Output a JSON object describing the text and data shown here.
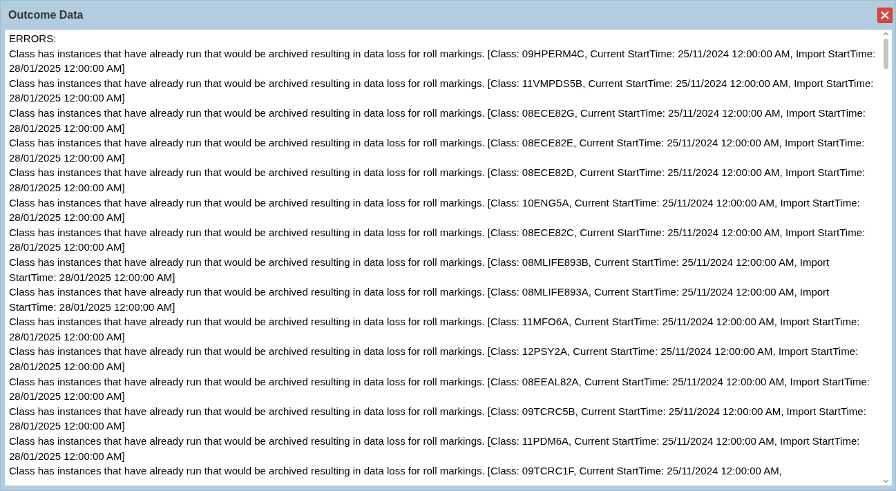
{
  "window": {
    "title": "Outcome Data"
  },
  "output": {
    "heading": "ERRORS:",
    "lines": [
      "Class has instances that have already run that would be archived resulting in data loss for roll markings. [Class: 09HPERM4C, Current StartTime: 25/11/2024 12:00:00 AM, Import StartTime: 28/01/2025 12:00:00 AM]",
      "Class has instances that have already run that would be archived resulting in data loss for roll markings. [Class: 11VMPDS5B, Current StartTime: 25/11/2024 12:00:00 AM, Import StartTime: 28/01/2025 12:00:00 AM]",
      "Class has instances that have already run that would be archived resulting in data loss for roll markings. [Class: 08ECE82G, Current StartTime: 25/11/2024 12:00:00 AM, Import StartTime: 28/01/2025 12:00:00 AM]",
      "Class has instances that have already run that would be archived resulting in data loss for roll markings. [Class: 08ECE82E, Current StartTime: 25/11/2024 12:00:00 AM, Import StartTime: 28/01/2025 12:00:00 AM]",
      "Class has instances that have already run that would be archived resulting in data loss for roll markings. [Class: 08ECE82D, Current StartTime: 25/11/2024 12:00:00 AM, Import StartTime: 28/01/2025 12:00:00 AM]",
      "Class has instances that have already run that would be archived resulting in data loss for roll markings. [Class: 10ENG5A, Current StartTime: 25/11/2024 12:00:00 AM, Import StartTime: 28/01/2025 12:00:00 AM]",
      "Class has instances that have already run that would be archived resulting in data loss for roll markings. [Class: 08ECE82C, Current StartTime: 25/11/2024 12:00:00 AM, Import StartTime: 28/01/2025 12:00:00 AM]",
      "Class has instances that have already run that would be archived resulting in data loss for roll markings. [Class: 08MLIFE893B, Current StartTime: 25/11/2024 12:00:00 AM, Import StartTime: 28/01/2025 12:00:00 AM]",
      "Class has instances that have already run that would be archived resulting in data loss for roll markings. [Class: 08MLIFE893A, Current StartTime: 25/11/2024 12:00:00 AM, Import StartTime: 28/01/2025 12:00:00 AM]",
      "Class has instances that have already run that would be archived resulting in data loss for roll markings. [Class: 11MFO6A, Current StartTime: 25/11/2024 12:00:00 AM, Import StartTime: 28/01/2025 12:00:00 AM]",
      "Class has instances that have already run that would be archived resulting in data loss for roll markings. [Class: 12PSY2A, Current StartTime: 25/11/2024 12:00:00 AM, Import StartTime: 28/01/2025 12:00:00 AM]",
      "Class has instances that have already run that would be archived resulting in data loss for roll markings. [Class: 08EEAL82A, Current StartTime: 25/11/2024 12:00:00 AM, Import StartTime: 28/01/2025 12:00:00 AM]",
      "Class has instances that have already run that would be archived resulting in data loss for roll markings. [Class: 09TCRC5B, Current StartTime: 25/11/2024 12:00:00 AM, Import StartTime: 28/01/2025 12:00:00 AM]",
      "Class has instances that have already run that would be archived resulting in data loss for roll markings. [Class: 11PDM6A, Current StartTime: 25/11/2024 12:00:00 AM, Import StartTime: 28/01/2025 12:00:00 AM]",
      "Class has instances that have already run that would be archived resulting in data loss for roll markings. [Class: 09TCRC1F, Current StartTime: 25/11/2024 12:00:00 AM,"
    ]
  }
}
